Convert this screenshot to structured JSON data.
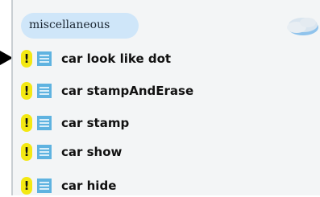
{
  "palette": {
    "category": {
      "label": "miscellaneous"
    },
    "blocks": [
      {
        "badge": "!",
        "label": "car look like dot"
      },
      {
        "badge": "!",
        "label": "car stampAndErase"
      },
      {
        "badge": "!",
        "label": "car stamp"
      },
      {
        "badge": "!",
        "label": "car show"
      },
      {
        "badge": "!",
        "label": "car hide"
      }
    ]
  },
  "icons": {
    "pointer": "arrow-pointer-icon",
    "cloud": "cloud-icon",
    "sprite": "sprite-icon",
    "warning": "warning-badge-icon"
  },
  "colors": {
    "category_tab": "#cfe6f9",
    "warning_badge": "#f3e812",
    "sprite_icon": "#5fb3e0",
    "panel_background": "#f3f5f6"
  }
}
